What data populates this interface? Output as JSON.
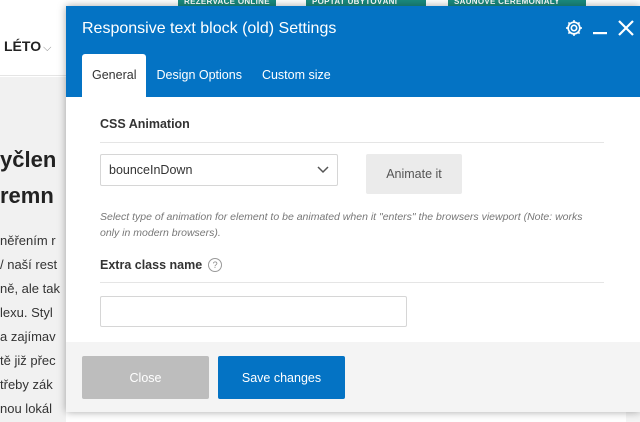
{
  "background": {
    "top_tags": [
      "REZERVACE ONLINE",
      "POPTAT UBYTOVÁNÍ",
      "SAUNOVÉ CEREMONIÁLY"
    ],
    "nav_item": "LÉTO",
    "heading_lines": [
      "yčlen",
      "remn"
    ],
    "text_lines": [
      "něřením r",
      "/ naší rest",
      "ně, ale tak",
      "lexu. Styl",
      "a zajímav",
      "tě již přec",
      "třeby zák",
      "nou lokál"
    ]
  },
  "modal": {
    "title": "Responsive text block (old) Settings",
    "tabs": [
      {
        "label": "General",
        "active": true
      },
      {
        "label": "Design Options",
        "active": false
      },
      {
        "label": "Custom size",
        "active": false
      }
    ],
    "css_animation": {
      "label": "CSS Animation",
      "selected": "bounceInDown",
      "animate_button": "Animate it",
      "help": "Select type of animation for element to be animated when it \"enters\" the browsers viewport (Note: works only in modern browsers)."
    },
    "extra_class": {
      "label": "Extra class name",
      "help_icon": "?",
      "value": ""
    },
    "footer": {
      "close_label": "Close",
      "save_label": "Save changes"
    }
  },
  "colors": {
    "header_blue": "#0473c4",
    "teal_tag": "#1a8a7e",
    "close_gray": "#bdbdbd"
  },
  "icons": [
    "gear-icon",
    "minimize-icon",
    "close-icon",
    "chevron-down-icon",
    "help-icon"
  ]
}
